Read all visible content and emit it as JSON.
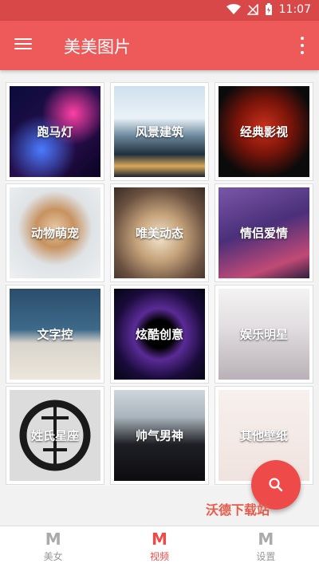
{
  "status": {
    "time": "11:07"
  },
  "appbar": {
    "title": "美美图片"
  },
  "grid": [
    {
      "label": "跑马灯",
      "img": "img-led"
    },
    {
      "label": "风景建筑",
      "img": "img-scene"
    },
    {
      "label": "经典影视",
      "img": "img-movie"
    },
    {
      "label": "动物萌宠",
      "img": "img-pet"
    },
    {
      "label": "唯美动态",
      "img": "img-dyn"
    },
    {
      "label": "情侣爱情",
      "img": "img-love"
    },
    {
      "label": "文字控",
      "img": "img-text"
    },
    {
      "label": "炫酷创意",
      "img": "img-cool"
    },
    {
      "label": "娱乐明星",
      "img": "img-star"
    },
    {
      "label": "姓氏星座",
      "img": "img-zodiac"
    },
    {
      "label": "帅气男神",
      "img": "img-boy"
    },
    {
      "label": "其他壁纸",
      "img": "img-other"
    }
  ],
  "watermark": "沃德下载站",
  "bottomnav": [
    {
      "icon": "M",
      "label": "美女",
      "active": false
    },
    {
      "icon": "M",
      "label": "视频",
      "active": true
    },
    {
      "icon": "M",
      "label": "设置",
      "active": false
    }
  ],
  "colors": {
    "primary": "#ee5a5a",
    "statusbar": "#d84848",
    "accent": "#ee4a4a"
  }
}
